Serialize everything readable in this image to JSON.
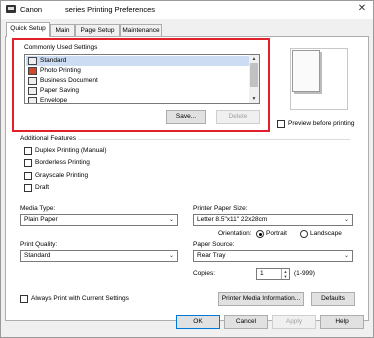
{
  "window": {
    "title": "Canon           series Printing Preferences",
    "close_glyph": "✕"
  },
  "tabs": [
    "Quick Setup",
    "Main",
    "Page Setup",
    "Maintenance"
  ],
  "commonly_used": {
    "heading": "Commonly Used Settings",
    "items": [
      "Standard",
      "Photo Printing",
      "Business Document",
      "Paper Saving",
      "Envelope"
    ],
    "save_label": "Save...",
    "delete_label": "Delete"
  },
  "preview_checkbox_label": "Preview before printing",
  "additional_features": {
    "heading": "Additional Features",
    "options": [
      "Duplex Printing (Manual)",
      "Borderless Printing",
      "Grayscale Printing",
      "Draft"
    ]
  },
  "media_type": {
    "label": "Media Type:",
    "value": "Plain Paper"
  },
  "printer_paper_size": {
    "label": "Printer Paper Size:",
    "value": "Letter 8.5\"x11\" 22x28cm"
  },
  "orientation": {
    "label": "Orientation:",
    "portrait": "Portrait",
    "landscape": "Landscape",
    "selected": "Portrait"
  },
  "print_quality": {
    "label": "Print Quality:",
    "value": "Standard"
  },
  "paper_source": {
    "label": "Paper Source:",
    "value": "Rear Tray"
  },
  "copies": {
    "label": "Copies:",
    "value": "1",
    "range": "(1-999)"
  },
  "always_print_label": "Always Print with Current Settings",
  "printer_media_info_label": "Printer Media Information...",
  "defaults_label": "Defaults",
  "footer": {
    "ok": "OK",
    "cancel": "Cancel",
    "apply": "Apply",
    "help": "Help"
  },
  "colors": {
    "highlight_box": "#e0202a",
    "selection": "#ccddf3",
    "focus_border": "#0078d7"
  },
  "icons": {
    "scroll_up": "▲",
    "scroll_down": "▼",
    "combo_arrow": "⌄",
    "spin_up": "▲",
    "spin_down": "▼"
  }
}
